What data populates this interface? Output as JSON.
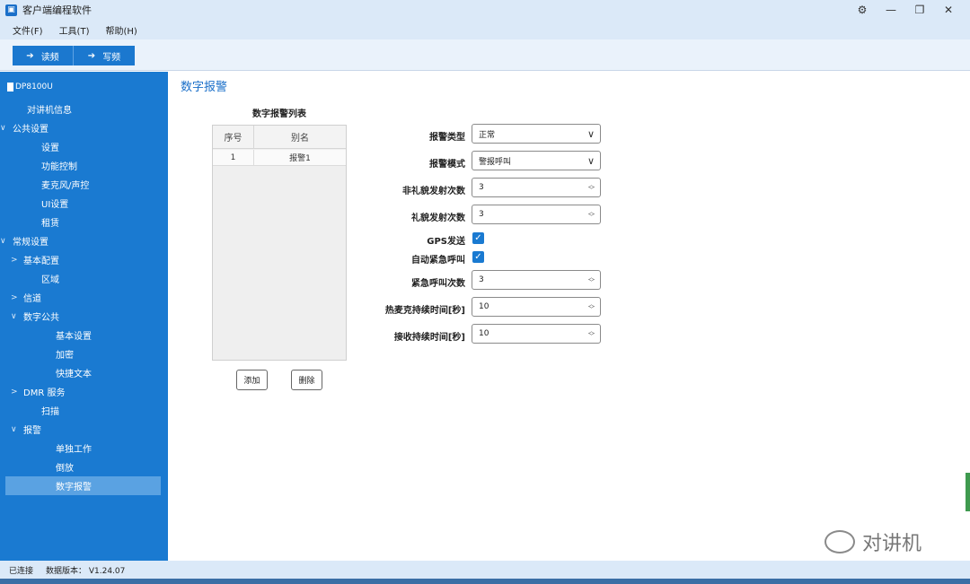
{
  "window": {
    "title": "客户端编程软件",
    "app_icon": "▣",
    "controls": [
      "⚙",
      "—",
      "❐",
      "✕"
    ]
  },
  "menu": {
    "items": [
      "文件(F)",
      "工具(T)",
      "帮助(H)"
    ]
  },
  "toolbar": {
    "read_label": "读频",
    "write_label": "写频"
  },
  "sidebar": {
    "device": "DP8100U",
    "items": [
      {
        "label": "对讲机信息",
        "chevron": ""
      },
      {
        "label": "公共设置",
        "chevron": "∨"
      },
      {
        "label": "设置",
        "chevron": ""
      },
      {
        "label": "功能控制",
        "chevron": ""
      },
      {
        "label": "麦克风/声控",
        "chevron": ""
      },
      {
        "label": "UI设置",
        "chevron": ""
      },
      {
        "label": "租赁",
        "chevron": ""
      },
      {
        "label": "常规设置",
        "chevron": "∨"
      },
      {
        "label": "基本配置",
        "chevron": ">"
      },
      {
        "label": "区域",
        "chevron": ""
      },
      {
        "label": "信道",
        "chevron": ">"
      },
      {
        "label": "数字公共",
        "chevron": "∨"
      },
      {
        "label": "基本设置",
        "chevron": ""
      },
      {
        "label": "加密",
        "chevron": ""
      },
      {
        "label": "快捷文本",
        "chevron": ""
      },
      {
        "label": "DMR 服务",
        "chevron": ">"
      },
      {
        "label": "扫描",
        "chevron": ""
      },
      {
        "label": "报警",
        "chevron": "∨"
      },
      {
        "label": "单独工作",
        "chevron": ""
      },
      {
        "label": "倒放",
        "chevron": ""
      },
      {
        "label": "数字报警",
        "chevron": ""
      }
    ],
    "selected": "数字报警"
  },
  "main": {
    "title": "数字报警",
    "list": {
      "title": "数字报警列表",
      "columns": [
        "序号",
        "别名"
      ],
      "rows": [
        [
          "1",
          "报警1"
        ]
      ],
      "add_label": "添加",
      "delete_label": "删除"
    },
    "form": {
      "alarm_type": {
        "label": "报警类型",
        "value": "正常"
      },
      "alarm_mode": {
        "label": "报警模式",
        "value": "警报呼叫"
      },
      "non_courtesy_count": {
        "label": "非礼貌发射次数",
        "value": "3"
      },
      "courtesy_count": {
        "label": "礼貌发射次数",
        "value": "3"
      },
      "gps_send": {
        "label": "GPS发送",
        "checked": true
      },
      "auto_emergency_call": {
        "label": "自动紧急呼叫",
        "checked": true
      },
      "emergency_call_count": {
        "label": "紧急呼叫次数",
        "value": "3"
      },
      "hot_mic_duration": {
        "label": "热麦克持续时间[秒]",
        "value": "10"
      },
      "receive_duration": {
        "label": "接收持续时间[秒]",
        "value": "10"
      }
    }
  },
  "status": {
    "connection": "已连接",
    "data_version": "数据版本： V1.24.07"
  },
  "watermark": {
    "text": "对讲机"
  },
  "colors": {
    "accent": "#1a7ad1",
    "sidebar": "#1a7ad1",
    "selected": "#5aa2e2",
    "title_blue": "#1a6fc9"
  }
}
